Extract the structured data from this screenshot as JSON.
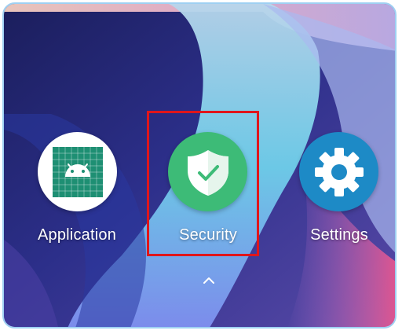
{
  "apps": [
    {
      "label": "Application",
      "icon": "android-app-icon",
      "color": "#ffffff"
    },
    {
      "label": "Security",
      "icon": "security-shield-icon",
      "color": "#3dbb77"
    },
    {
      "label": "Settings",
      "icon": "settings-gear-icon",
      "color": "#1d8ac6"
    }
  ],
  "drawer_hint_icon": "chevron-up-icon",
  "highlight_color": "#e0161b"
}
